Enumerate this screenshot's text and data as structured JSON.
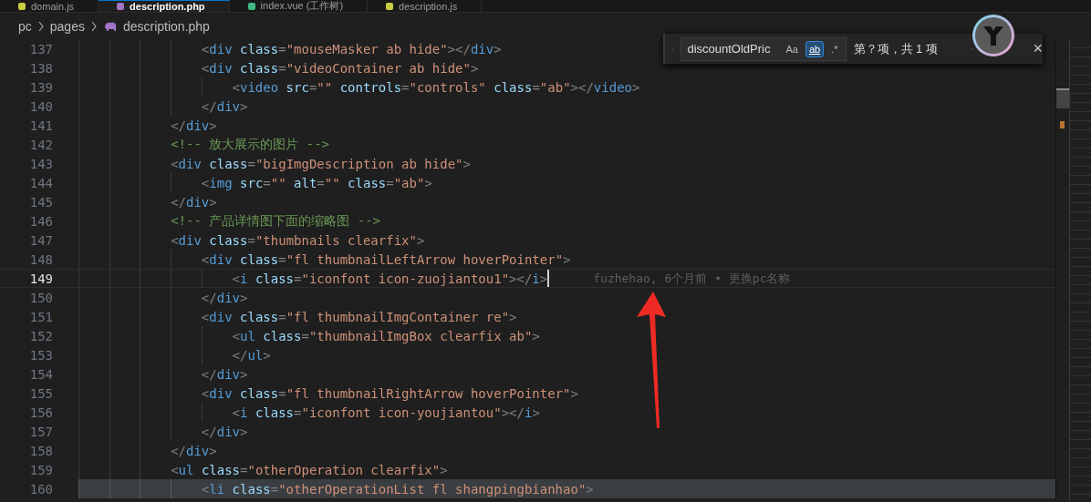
{
  "tabs": [
    {
      "label": "domain.js",
      "selected": false,
      "kind": "script"
    },
    {
      "label": "description.php",
      "selected": true,
      "kind": "php"
    },
    {
      "label": "index.vue (工作树)",
      "selected": false,
      "kind": "vue"
    },
    {
      "label": "description.js",
      "selected": false,
      "kind": "script"
    }
  ],
  "breadcrumb": [
    "pc",
    "pages",
    "description.php"
  ],
  "find": {
    "value": "discountOldPric",
    "options": [
      {
        "label": "Aa",
        "selected": false
      },
      {
        "label": "ab",
        "selected": true
      },
      {
        "label": ".*",
        "selected": false
      }
    ],
    "result": "第？项，共 1 项",
    "close": "×"
  },
  "lines": [
    {
      "number": "137",
      "code": "                <div class=\"mouseMasker ab hide\"></div>",
      "current": false,
      "selected": false
    },
    {
      "number": "138",
      "code": "                <div class=\"videoContainer ab hide\">",
      "current": false,
      "selected": false
    },
    {
      "number": "139",
      "code": "                    <video src=\"\" controls=\"controls\" class=\"ab\"></video>",
      "current": false,
      "selected": false
    },
    {
      "number": "140",
      "code": "                </div>",
      "current": false,
      "selected": false
    },
    {
      "number": "141",
      "code": "            </div>",
      "current": false,
      "selected": false
    },
    {
      "number": "142",
      "code": "            <!-- 放大展示的图片 -->",
      "current": false,
      "selected": false
    },
    {
      "number": "143",
      "code": "            <div class=\"bigImgDescription ab hide\">",
      "current": false,
      "selected": false
    },
    {
      "number": "144",
      "code": "                <img src=\"\" alt=\"\" class=\"ab\">",
      "current": false,
      "selected": false
    },
    {
      "number": "145",
      "code": "            </div>",
      "current": false,
      "selected": false
    },
    {
      "number": "146",
      "code": "            <!-- 产品详情图下面的缩略图 -->",
      "current": false,
      "selected": false
    },
    {
      "number": "147",
      "code": "            <div class=\"thumbnails clearfix\">",
      "current": false,
      "selected": false
    },
    {
      "number": "148",
      "code": "                <div class=\"fl thumbnailLeftArrow hoverPointer\">",
      "current": false,
      "selected": false
    },
    {
      "number": "149",
      "code": "                    <i class=\"iconfont icon-zuojiantou1\"></i>",
      "current": true,
      "selected": false,
      "blame": "fuzhehao, 6个月前 • 更换pc名称"
    },
    {
      "number": "150",
      "code": "                </div>",
      "current": false,
      "selected": false
    },
    {
      "number": "151",
      "code": "                <div class=\"fl thumbnailImgContainer re\">",
      "current": false,
      "selected": false
    },
    {
      "number": "152",
      "code": "                    <ul class=\"thumbnailImgBox clearfix ab\">",
      "current": false,
      "selected": false
    },
    {
      "number": "153",
      "code": "                    </ul>",
      "current": false,
      "selected": false
    },
    {
      "number": "154",
      "code": "                </div>",
      "current": false,
      "selected": false
    },
    {
      "number": "155",
      "code": "                <div class=\"fl thumbnailRightArrow hoverPointer\">",
      "current": false,
      "selected": false
    },
    {
      "number": "156",
      "code": "                    <i class=\"iconfont icon-youjiantou\"></i>",
      "current": false,
      "selected": false
    },
    {
      "number": "157",
      "code": "                </div>",
      "current": false,
      "selected": false
    },
    {
      "number": "158",
      "code": "            </div>",
      "current": false,
      "selected": false
    },
    {
      "number": "159",
      "code": "            <ul class=\"otherOperation clearfix\">",
      "current": false,
      "selected": false
    },
    {
      "number": "160",
      "code": "                <li class=\"otherOperationList fl shangpingbianhao\">",
      "current": false,
      "selected": true
    }
  ]
}
